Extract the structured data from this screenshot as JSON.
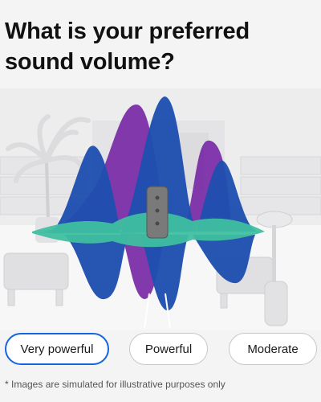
{
  "question": {
    "line1": "What is your preferred",
    "line2": "sound volume?"
  },
  "illustration": {
    "subject": "speaker-on-patio",
    "wave_colors": {
      "purple": "#7b2fa8",
      "blue": "#1f4fb0",
      "teal": "#3fbfa0"
    },
    "speaker_color": "#7a7a7a"
  },
  "options": [
    {
      "label": "Very powerful",
      "selected": true
    },
    {
      "label": "Powerful",
      "selected": false
    },
    {
      "label": "Moderate",
      "selected": false
    }
  ],
  "accent_color": "#1565e0",
  "disclaimer": "* Images are simulated for illustrative purposes only"
}
